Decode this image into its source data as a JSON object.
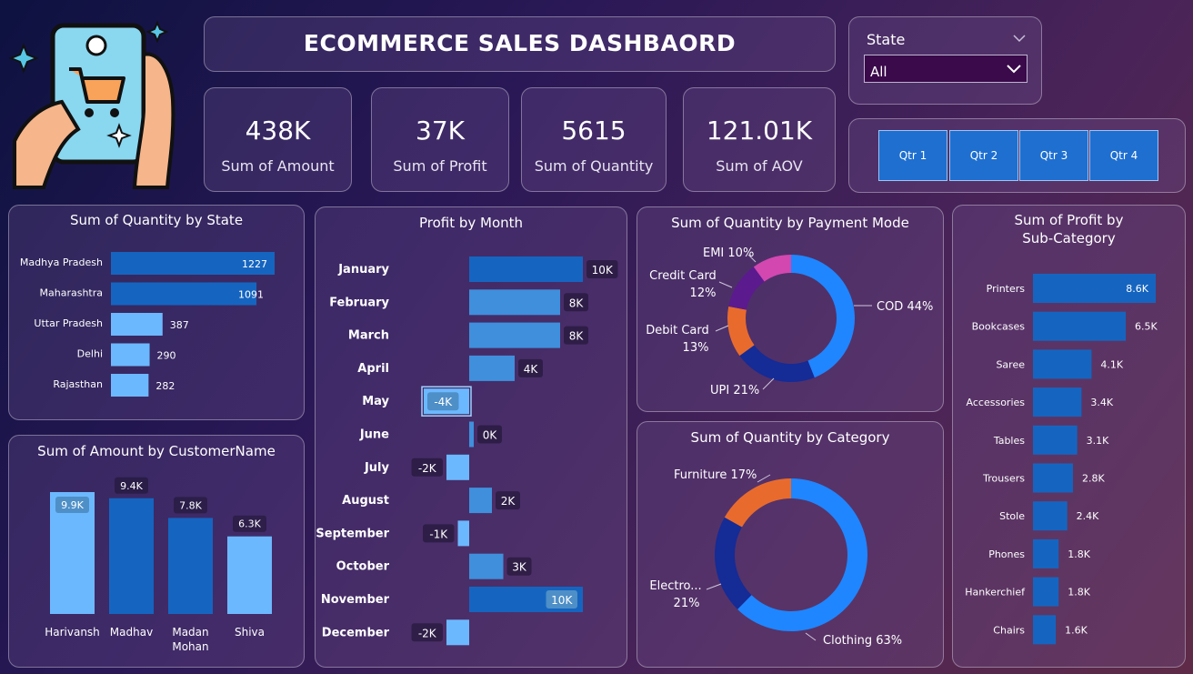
{
  "header": {
    "title": "ECOMMERCE SALES DASHBAORD"
  },
  "filter": {
    "label": "State",
    "value": "All"
  },
  "quarters": [
    "Qtr 1",
    "Qtr 2",
    "Qtr 3",
    "Qtr 4"
  ],
  "kpis": [
    {
      "value": "438K",
      "label": "Sum of Amount"
    },
    {
      "value": "37K",
      "label": "Sum of Profit"
    },
    {
      "value": "5615",
      "label": "Sum of Quantity"
    },
    {
      "value": "121.01K",
      "label": "Sum of AOV"
    }
  ],
  "colors": {
    "primary": "#1565c0",
    "light": "#6cb8ff",
    "mid": "#3f8fdc",
    "dark": "#152b96",
    "orange": "#e86b2d",
    "purple": "#5b1a8e",
    "pink": "#d247b0",
    "bright": "#1f86ff"
  },
  "chart_data": [
    {
      "id": "qty_by_state",
      "type": "bar",
      "orientation": "horizontal",
      "title": "Sum of Quantity by State",
      "categories": [
        "Madhya Pradesh",
        "Maharashtra",
        "Uttar Pradesh",
        "Delhi",
        "Rajasthan"
      ],
      "values": [
        1227,
        1091,
        387,
        290,
        282
      ]
    },
    {
      "id": "amount_by_customer",
      "type": "bar",
      "orientation": "vertical",
      "title": "Sum of Amount by CustomerName",
      "categories": [
        "Harivansh",
        "Madhav",
        "Madan Mohan",
        "Shiva"
      ],
      "values": [
        9.9,
        9.4,
        7.8,
        6.3
      ],
      "labels": [
        "9.9K",
        "9.4K",
        "7.8K",
        "6.3K"
      ]
    },
    {
      "id": "profit_by_month",
      "type": "bar",
      "orientation": "horizontal",
      "title": "Profit by Month",
      "categories": [
        "January",
        "February",
        "March",
        "April",
        "May",
        "June",
        "July",
        "August",
        "September",
        "October",
        "November",
        "December"
      ],
      "values": [
        10,
        8,
        8,
        4,
        -4,
        0,
        -2,
        2,
        -1,
        3,
        10,
        -2
      ],
      "labels": [
        "10K",
        "8K",
        "8K",
        "4K",
        "-4K",
        "0K",
        "-2K",
        "2K",
        "-1K",
        "3K",
        "10K",
        "-2K"
      ]
    },
    {
      "id": "qty_by_payment",
      "type": "pie",
      "style": "donut",
      "title": "Sum of Quantity by Payment Mode",
      "categories": [
        "COD",
        "UPI",
        "Debit Card",
        "Credit Card",
        "EMI"
      ],
      "values": [
        44,
        21,
        13,
        12,
        10
      ]
    },
    {
      "id": "qty_by_category",
      "type": "pie",
      "style": "donut",
      "title": "Sum of Quantity by Category",
      "categories": [
        "Clothing",
        "Electro...",
        "Furniture"
      ],
      "values": [
        63,
        21,
        17
      ]
    },
    {
      "id": "profit_by_subcategory",
      "type": "bar",
      "orientation": "horizontal",
      "title": "Sum of Profit by Sub-Category",
      "categories": [
        "Printers",
        "Bookcases",
        "Saree",
        "Accessories",
        "Tables",
        "Trousers",
        "Stole",
        "Phones",
        "Hankerchief",
        "Chairs"
      ],
      "values": [
        8.6,
        6.5,
        4.1,
        3.4,
        3.1,
        2.8,
        2.4,
        1.8,
        1.8,
        1.6
      ],
      "labels": [
        "8.6K",
        "6.5K",
        "4.1K",
        "3.4K",
        "3.1K",
        "2.8K",
        "2.4K",
        "1.8K",
        "1.8K",
        "1.6K"
      ]
    }
  ]
}
